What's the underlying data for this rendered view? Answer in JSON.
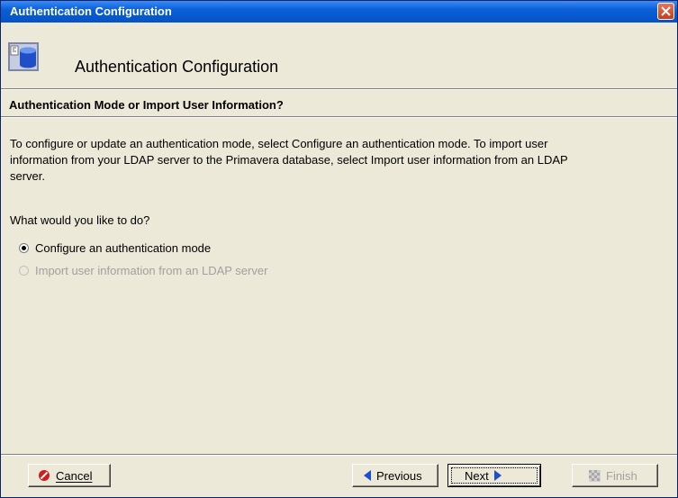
{
  "window": {
    "title": "Authentication Configuration"
  },
  "header": {
    "title": "Authentication Configuration"
  },
  "section": {
    "title": "Authentication Mode or Import User Information?"
  },
  "body": {
    "intro_line1": "To configure or update an authentication mode, select Configure an authentication mode.  To import user",
    "intro_line2": "information from your LDAP server to the Primavera database, select Import user information from an LDAP",
    "intro_line3": "server.",
    "question": "What would you like to do?"
  },
  "options": [
    {
      "label": "Configure an authentication mode",
      "selected": true,
      "enabled": true
    },
    {
      "label": "Import user information from an LDAP server",
      "selected": false,
      "enabled": false
    }
  ],
  "buttons": {
    "cancel": "Cancel",
    "previous": "Previous",
    "next": "Next",
    "finish": "Finish"
  },
  "colors": {
    "titlebar": "#0553c4",
    "dialog_bg": "#ece9d8",
    "close_button": "#c23d1e",
    "arrow_blue": "#1f4fd1",
    "cancel_red": "#d21c1c"
  }
}
